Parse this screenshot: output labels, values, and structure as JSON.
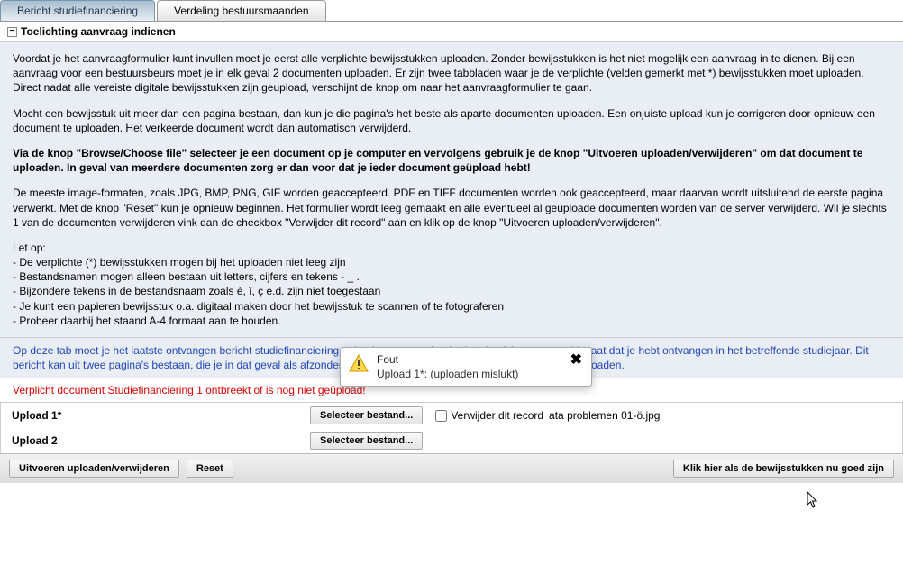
{
  "tabs": {
    "t1": "Bericht studiefinanciering",
    "t2": "Verdeling bestuursmaanden"
  },
  "section_title": "Toelichting aanvraag indienen",
  "paragraphs": {
    "p1": "Voordat je het aanvraagformulier kunt invullen moet je eerst alle verplichte bewijsstukken uploaden. Zonder bewijsstukken is het niet mogelijk een aanvraag in te dienen. Bij een aanvraag voor een bestuursbeurs moet je in elk geval 2 documenten uploaden. Er zijn twee tabbladen waar je de verplichte (velden gemerkt met *) bewijsstukken moet uploaden. Direct nadat alle vereiste digitale bewijsstukken zijn geupload, verschijnt de knop om naar het aanvraagformulier te gaan.",
    "p2": "Mocht een bewijsstuk uit meer dan een pagina bestaan, dan kun je die pagina's het beste als aparte documenten uploaden. Een onjuiste upload kun je corrigeren door opnieuw een document te uploaden. Het verkeerde document wordt dan automatisch verwijderd.",
    "p3_bold": "Via de knop \"Browse/Choose file\" selecteer je een document op je computer en vervolgens gebruik je de knop \"Uitvoeren uploaden/verwijderen\" om dat document te uploaden. In geval van meerdere documenten zorg er dan voor dat je ieder document geüpload hebt!",
    "p4": "De meeste image-formaten, zoals JPG, BMP, PNG, GIF worden geaccepteerd. PDF en TIFF documenten worden ook geaccepteerd, maar daarvan wordt uitsluitend de eerste pagina verwerkt. Met de knop \"Reset\" kun je opnieuw beginnen. Het formulier wordt leeg gemaakt en alle eventueel al geuploade documenten worden van de server verwijderd. Wil je slechts 1 van de documenten verwijderen vink dan de checkbox \"Verwijder dit record\" aan en klik op de knop \"Uitvoeren uploaden/verwijderen\".",
    "notes_head": "Let op:",
    "n1": "- De verplichte (*) bewijsstukken mogen bij het uploaden niet leeg zijn",
    "n2": "- Bestandsnamen mogen alleen bestaan uit letters, cijfers en tekens - _ .",
    "n3": "- Bijzondere tekens in de bestandsnaam zoals é, ï, ç e.d. zijn niet toegestaan",
    "n4": "- Je kunt een papieren bewijsstuk o.a. digitaal maken door het bewijsstuk te scannen of te fotograferen",
    "n5": "- Probeer daarbij het staand A-4 formaat aan te houden."
  },
  "info": "Op deze tab moet je het laatste ontvangen bericht studiefinanciering uploaden, waarop het bedrag basisbeurs vermeld staat dat je hebt ontvangen in het betreffende studiejaar. Dit bericht kan uit twee pagina's bestaan, die je in dat geval als afzonderlijke documenten met verschillende namen moet uploaden.",
  "error": "Verplicht document Studiefinanciering 1 ontbreekt of is nog niet geüpload!",
  "uploads": {
    "label1": "Upload 1*",
    "label2": "Upload 2",
    "select_btn": "Selecteer bestand...",
    "remove_label": "Verwijder dit record",
    "filename": "ata problemen 01-ö.jpg"
  },
  "buttons": {
    "execute": "Uitvoeren uploaden/verwijderen",
    "reset": "Reset",
    "continue": "Klik hier als de bewijsstukken nu goed zijn"
  },
  "popup": {
    "title": "Fout",
    "message": "Upload 1*: (uploaden mislukt)"
  }
}
